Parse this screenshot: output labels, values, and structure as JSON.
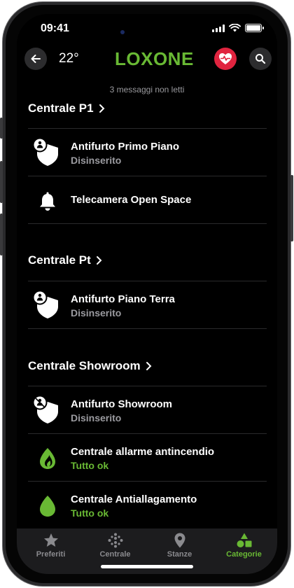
{
  "status": {
    "time": "09:41"
  },
  "header": {
    "temperature": "22°",
    "logo": "LOXONE"
  },
  "notice": "3 messaggi non letti",
  "sections": [
    {
      "title": "Centrale P1",
      "items": [
        {
          "title": "Antifurto Primo Piano",
          "subtitle": "Disinserito",
          "icon": "shield-person-icon"
        },
        {
          "title": "Telecamera Open Space",
          "subtitle": "",
          "icon": "bell-icon"
        }
      ]
    },
    {
      "title": "Centrale Pt",
      "items": [
        {
          "title": "Antifurto Piano Terra",
          "subtitle": "Disinserito",
          "icon": "shield-person-icon"
        }
      ]
    },
    {
      "title": "Centrale Showroom",
      "items": [
        {
          "title": "Antifurto Showroom",
          "subtitle": "Disinserito",
          "icon": "shield-person-off-icon"
        },
        {
          "title": "Centrale allarme antincendio",
          "subtitle": "Tutto ok",
          "icon": "fire-drop-icon"
        },
        {
          "title": "Centrale Antiallagamento",
          "subtitle": "Tutto ok",
          "icon": "water-drop-icon"
        }
      ]
    }
  ],
  "tabs": [
    {
      "label": "Preferiti",
      "icon": "star-icon",
      "active": false
    },
    {
      "label": "Centrale",
      "icon": "dots-icon",
      "active": false
    },
    {
      "label": "Stanze",
      "icon": "location-pin-icon",
      "active": false
    },
    {
      "label": "Categorie",
      "icon": "shapes-icon",
      "active": true
    }
  ],
  "colors": {
    "accent": "#69b934",
    "alert": "#e0243f",
    "background": "#000000",
    "muted": "#9b9ba0"
  }
}
